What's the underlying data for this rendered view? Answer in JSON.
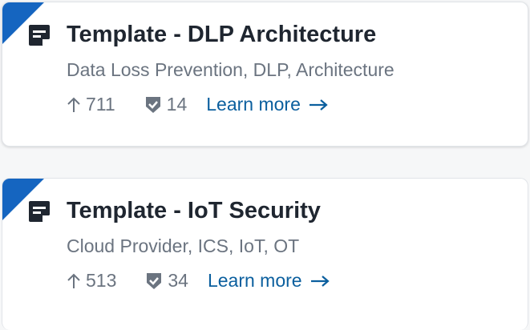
{
  "colors": {
    "accent": "#1565c0",
    "link": "#0b5f9e",
    "title": "#1f2630",
    "muted": "#6b7480"
  },
  "cards": [
    {
      "title": "Template - DLP Architecture",
      "tags": "Data Loss Prevention, DLP, Architecture",
      "upvotes": "711",
      "verified": "14",
      "link": "Learn more",
      "icon": "template-doc-icon"
    },
    {
      "title": "Template - IoT Security",
      "tags": "Cloud Provider, ICS, IoT, OT",
      "upvotes": "513",
      "verified": "34",
      "link": "Learn more",
      "icon": "template-doc-icon"
    }
  ]
}
